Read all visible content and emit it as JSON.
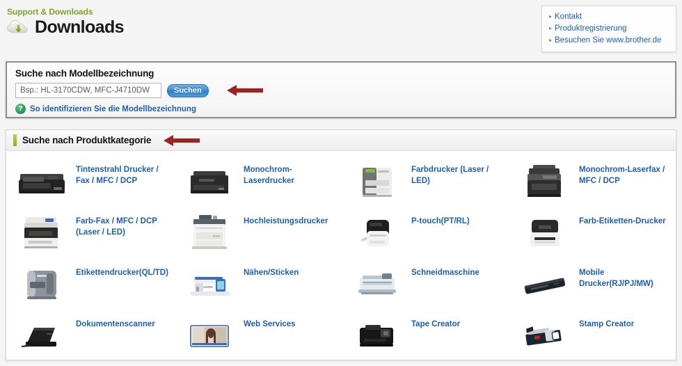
{
  "header": {
    "breadcrumb": "Support & Downloads",
    "title": "Downloads",
    "icon": "cloud-download-icon"
  },
  "link_panel": {
    "bullet": "▸",
    "items": [
      {
        "label": "Kontakt",
        "icon": "triangle-right-icon"
      },
      {
        "label": "Produktregistrierung",
        "icon": "triangle-right-icon"
      },
      {
        "label": "Besuchen Sie www.brother.de",
        "icon": "triangle-right-icon"
      }
    ]
  },
  "model_search": {
    "heading": "Suche nach Modellbezeichnung",
    "input_value": "",
    "input_placeholder": "Bsp.: HL-3170CDW, MFC-J4710DW",
    "button_label": "Suchen",
    "help_icon_glyph": "?",
    "help_link": "So identifizieren Sie die Modellbezeichnung",
    "annotation_arrow": "red-left-arrow"
  },
  "category_search": {
    "heading": "Suche nach Produktkategorie",
    "annotation_arrow": "red-left-arrow",
    "items": [
      {
        "label": "Tintenstrahl Drucker / Fax / MFC / DCP",
        "thumb": "inkjet-mfc-thumb"
      },
      {
        "label": "Monochrom-Laserdrucker",
        "thumb": "mono-laser-printer-thumb"
      },
      {
        "label": "Farbdrucker (Laser / LED)",
        "thumb": "color-laser-printer-thumb"
      },
      {
        "label": "Monochrom-Laserfax / MFC / DCP",
        "thumb": "mono-laser-mfc-thumb"
      },
      {
        "label": "Farb-Fax / MFC / DCP (Laser / LED)",
        "thumb": "color-laser-mfc-thumb"
      },
      {
        "label": "Hochleistungsdrucker",
        "thumb": "high-volume-printer-thumb"
      },
      {
        "label": "P-touch(PT/RL)",
        "thumb": "ptouch-labeler-thumb"
      },
      {
        "label": "Farb-Etiketten-Drucker",
        "thumb": "color-label-printer-thumb"
      },
      {
        "label": "Etikettendrucker(QL/TD)",
        "thumb": "label-printer-ql-thumb"
      },
      {
        "label": "Nähen/Sticken",
        "thumb": "sewing-machine-thumb"
      },
      {
        "label": "Schneidmaschine",
        "thumb": "cutting-machine-thumb"
      },
      {
        "label": "Mobile Drucker(RJ/PJ/MW)",
        "thumb": "mobile-printer-thumb"
      },
      {
        "label": "Dokumentenscanner",
        "thumb": "document-scanner-thumb"
      },
      {
        "label": "Web Services",
        "thumb": "web-services-thumb"
      },
      {
        "label": "Tape Creator",
        "thumb": "tape-creator-thumb"
      },
      {
        "label": "Stamp Creator",
        "thumb": "stamp-creator-thumb"
      }
    ]
  },
  "colors": {
    "breadcrumb_green": "#7fa32a",
    "link_blue": "#1d5fa8",
    "accent_olive": "#8fae2b",
    "arrow_red": "#9e2220",
    "button_blue": "#3b8fd4"
  }
}
